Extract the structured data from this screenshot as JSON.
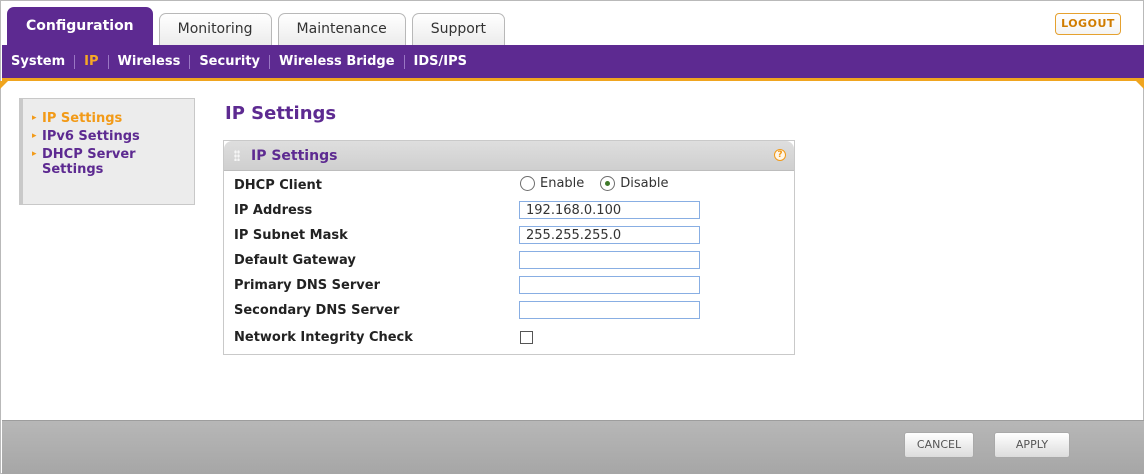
{
  "tabs": [
    "Configuration",
    "Monitoring",
    "Maintenance",
    "Support"
  ],
  "logout_label": "LOGOUT",
  "subnav": [
    "System",
    "IP",
    "Wireless",
    "Security",
    "Wireless Bridge",
    "IDS/IPS"
  ],
  "sidebar": {
    "items": [
      {
        "label": "IP Settings",
        "active": true
      },
      {
        "label": "IPv6 Settings",
        "active": false
      },
      {
        "label": "DHCP Server Settings",
        "active": false
      }
    ]
  },
  "page_title": "IP Settings",
  "panel": {
    "title": "IP Settings",
    "help_icon": "?",
    "dhcp_client_label": "DHCP Client",
    "dhcp_options": [
      "Enable",
      "Disable"
    ],
    "dhcp_selected": "Disable",
    "ip_address_label": "IP Address",
    "ip_address_value": "192.168.0.100",
    "subnet_label": "IP Subnet Mask",
    "subnet_value": "255.255.255.0",
    "gateway_label": "Default Gateway",
    "gateway_value": "",
    "primary_dns_label": "Primary DNS Server",
    "primary_dns_value": "",
    "secondary_dns_label": "Secondary DNS Server",
    "secondary_dns_value": "",
    "integrity_label": "Network Integrity Check",
    "integrity_checked": false
  },
  "buttons": {
    "cancel": "CANCEL",
    "apply": "APPLY"
  },
  "colors": {
    "brand_purple": "#5d2a91",
    "accent_orange": "#f29a17",
    "toolbar_gray": "#aeaeae"
  }
}
